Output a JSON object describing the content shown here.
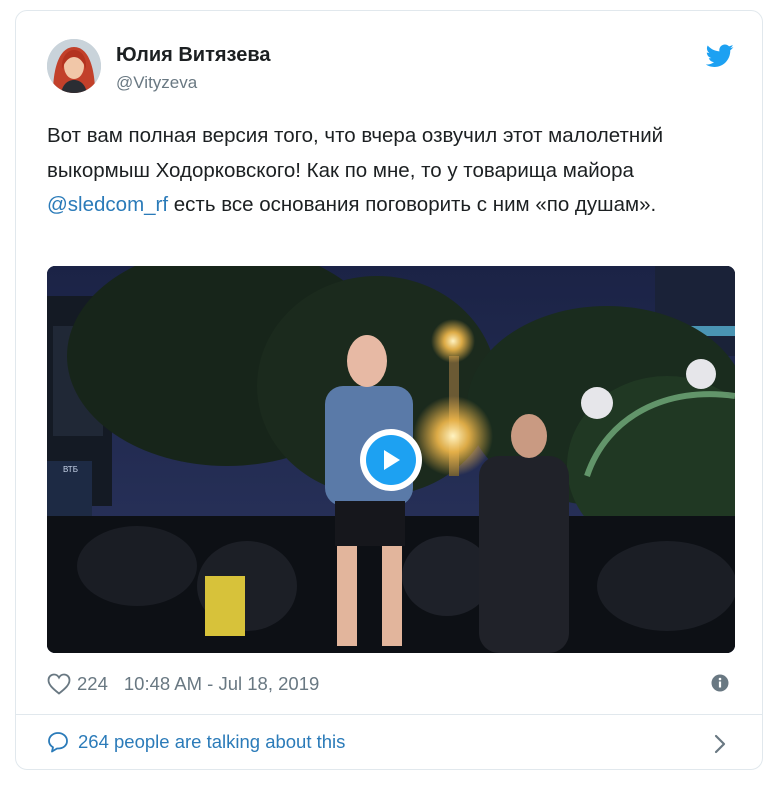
{
  "author": {
    "name": "Юлия Витязева",
    "handle": "@Vityzeva",
    "avatar_icon": "profile-photo"
  },
  "tweet": {
    "text_before": "Вот вам полная версия того, что вчера озвучил этот малолетний выкормыш Ходорковского! Как по мне, то у товарища майора ",
    "mention": "@sledcom_rf",
    "text_after": " есть все основания поговорить с ним «по душам»."
  },
  "media": {
    "type": "video",
    "play_icon": "play-icon",
    "sign_text": "ВТБ"
  },
  "meta": {
    "likes": "224",
    "timestamp": "10:48 AM - Jul 18, 2019"
  },
  "footer": {
    "talking_text": "264 people are talking about this"
  },
  "colors": {
    "brand": "#1da1f2",
    "link": "#2b7bb9",
    "muted": "#697882",
    "border": "#e1e8ed"
  }
}
